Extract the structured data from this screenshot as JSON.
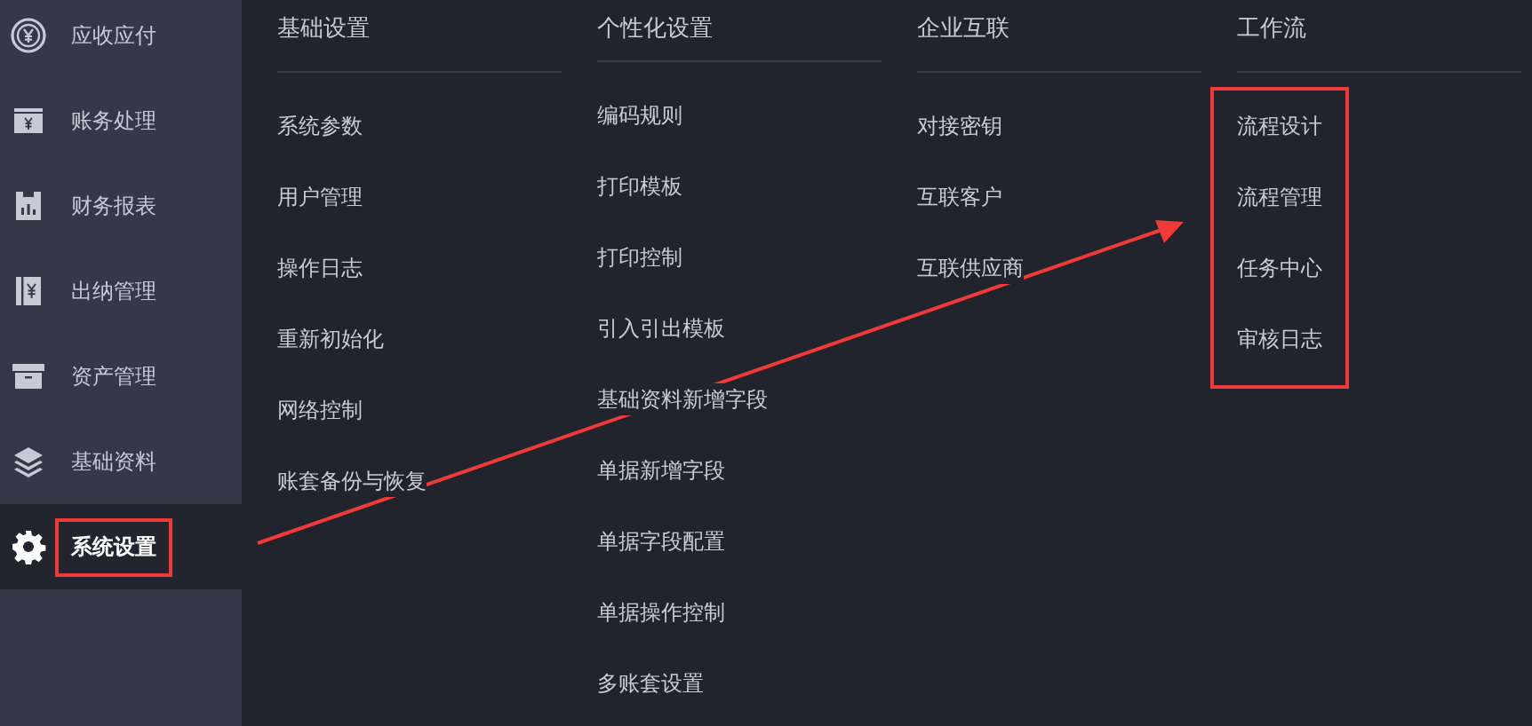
{
  "sidebar": {
    "items": [
      {
        "label": "应收应付",
        "selected": false,
        "highlighted": false
      },
      {
        "label": "账务处理",
        "selected": false,
        "highlighted": false
      },
      {
        "label": "财务报表",
        "selected": false,
        "highlighted": false
      },
      {
        "label": "出纳管理",
        "selected": false,
        "highlighted": false
      },
      {
        "label": "资产管理",
        "selected": false,
        "highlighted": false
      },
      {
        "label": "基础资料",
        "selected": false,
        "highlighted": false
      },
      {
        "label": "系统设置",
        "selected": true,
        "highlighted": true
      }
    ]
  },
  "menu": {
    "columns": [
      {
        "title": "基础设置",
        "highlighted": false,
        "items": [
          "系统参数",
          "用户管理",
          "操作日志",
          "重新初始化",
          "网络控制",
          "账套备份与恢复"
        ]
      },
      {
        "title": "个性化设置",
        "highlighted": false,
        "items": [
          "编码规则",
          "打印模板",
          "打印控制",
          "引入引出模板",
          "基础资料新增字段",
          "单据新增字段",
          "单据字段配置",
          "单据操作控制",
          "多账套设置"
        ]
      },
      {
        "title": "企业互联",
        "highlighted": false,
        "items": [
          "对接密钥",
          "互联客户",
          "互联供应商"
        ]
      },
      {
        "title": "工作流",
        "highlighted": true,
        "items": [
          "流程设计",
          "流程管理",
          "任务中心",
          "审核日志"
        ]
      }
    ]
  }
}
